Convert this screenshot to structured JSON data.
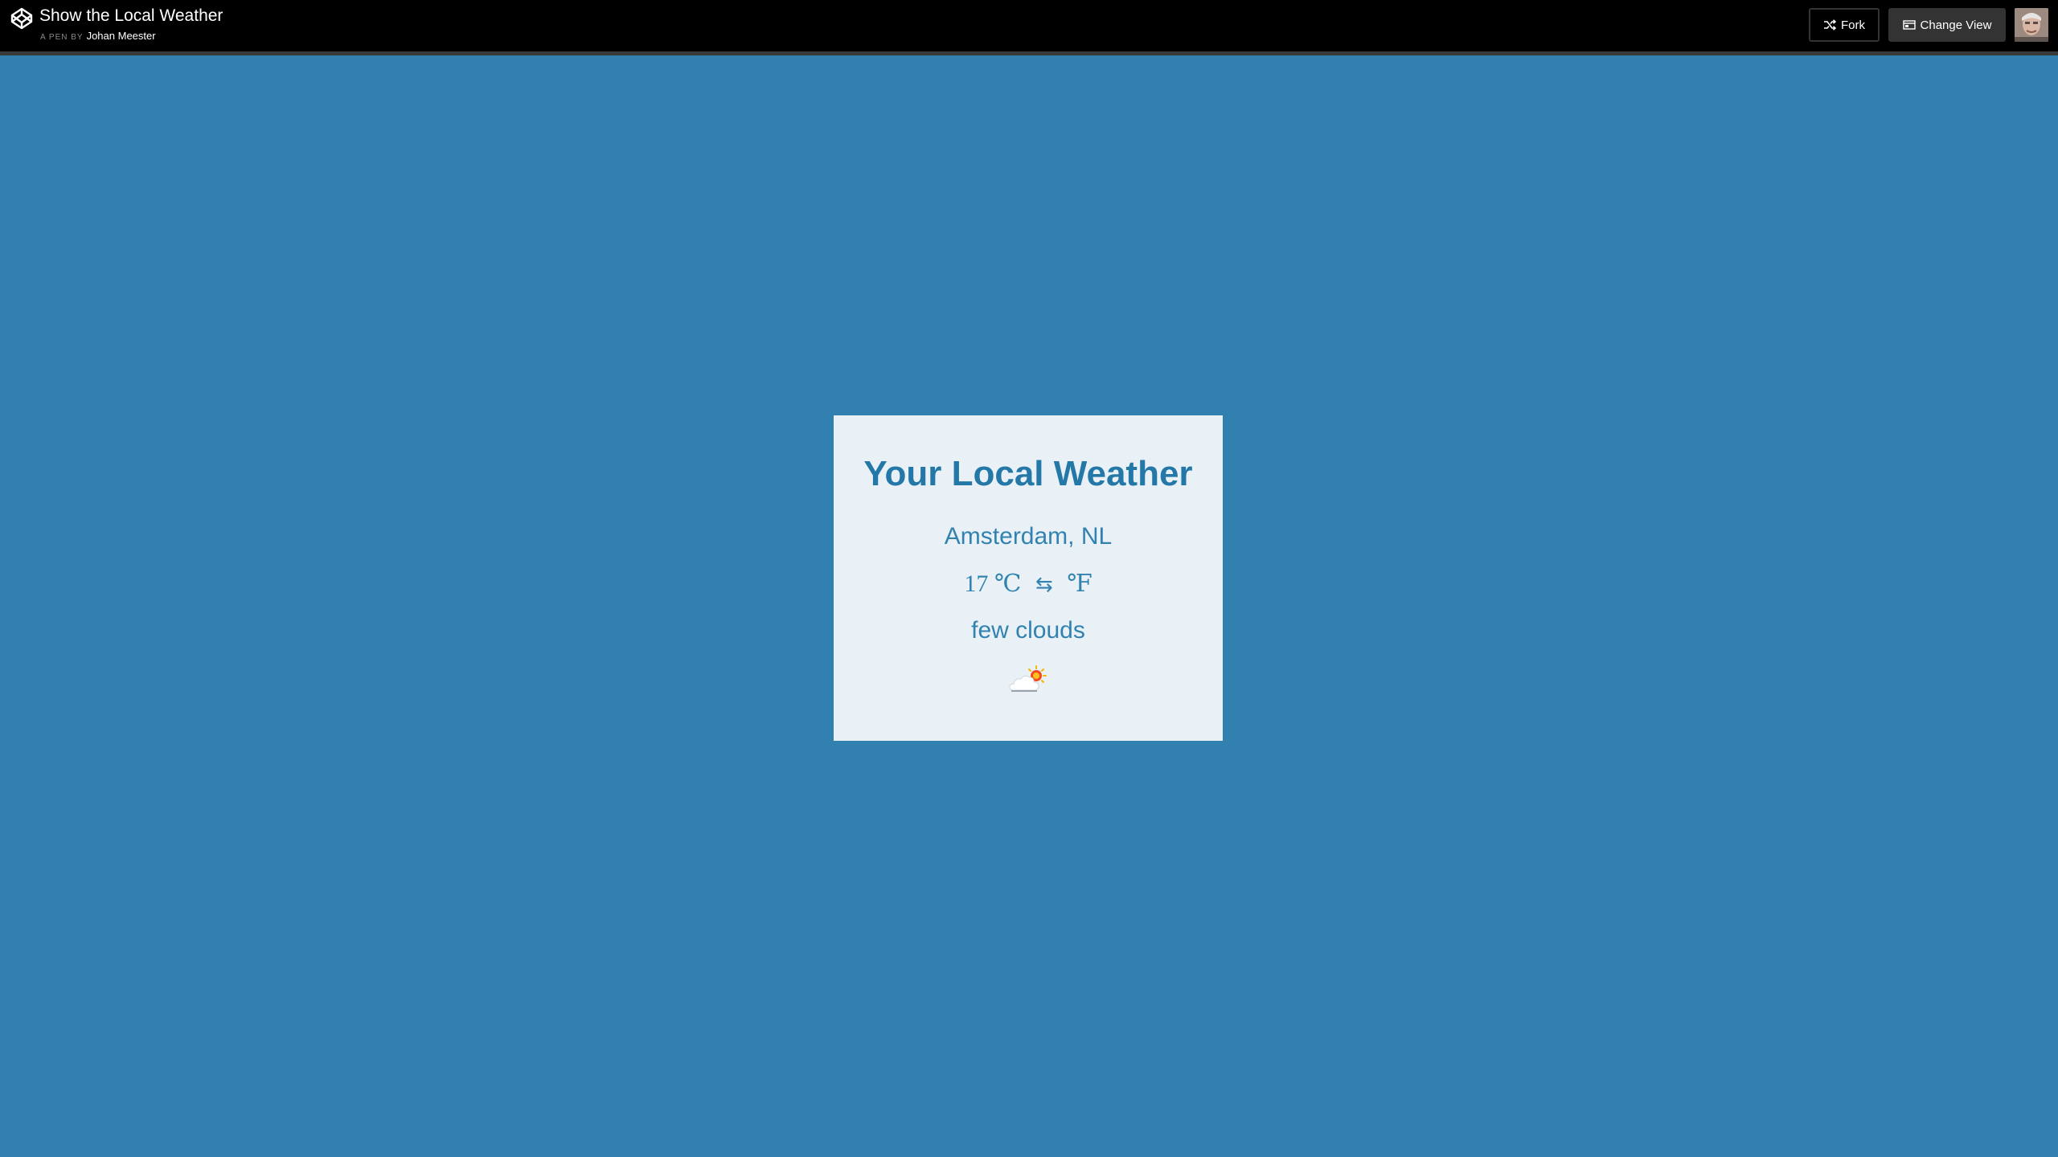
{
  "header": {
    "title": "Show the Local Weather",
    "byline_prefix": "A PEN BY",
    "author": "Johan Meester",
    "logo_icon": "codepen-logo-icon",
    "fork_label": "Fork",
    "fork_icon": "fork-icon",
    "change_view_label": "Change View",
    "change_view_icon": "layout-icon",
    "avatar": "user-avatar"
  },
  "weather": {
    "heading": "Your Local Weather",
    "location": "Amsterdam, NL",
    "temperature": "17",
    "unit_c": "℃",
    "toggle_symbol": "⇆",
    "unit_f": "℉",
    "description": "few clouds",
    "icon": "few-clouds-icon"
  },
  "colors": {
    "background": "#3280b0",
    "topbar": "#000000",
    "card": "#e9f1f7",
    "heading": "#2478a8",
    "text": "#3282b0"
  }
}
